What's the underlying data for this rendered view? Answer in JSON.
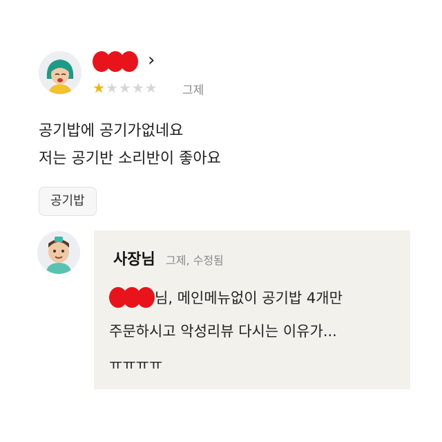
{
  "review": {
    "name_chevron": "›",
    "rating": 1,
    "max_rating": 5,
    "date": "그제",
    "body_lines": [
      "공기밥에 공기가없네요",
      "저는 공기반 소리반이 좋아요"
    ],
    "menu_tag": "공기밥"
  },
  "reply": {
    "owner_name": "사장님",
    "meta": "그제, 수정됨",
    "line1_suffix": "님, 메인메뉴없이 공기밥 4개만",
    "line2": "주문하시고 악성리뷰 다시는 이유가...",
    "line3": "ㅠㅠㅠㅠ"
  },
  "colors": {
    "redaction": "#e8131b",
    "star_active": "#f5b400",
    "star_inactive": "#d6d6d6",
    "reply_background": "#f3f1ec"
  },
  "icons": {
    "chevron": "chevron-right-icon",
    "star": "star-icon"
  }
}
